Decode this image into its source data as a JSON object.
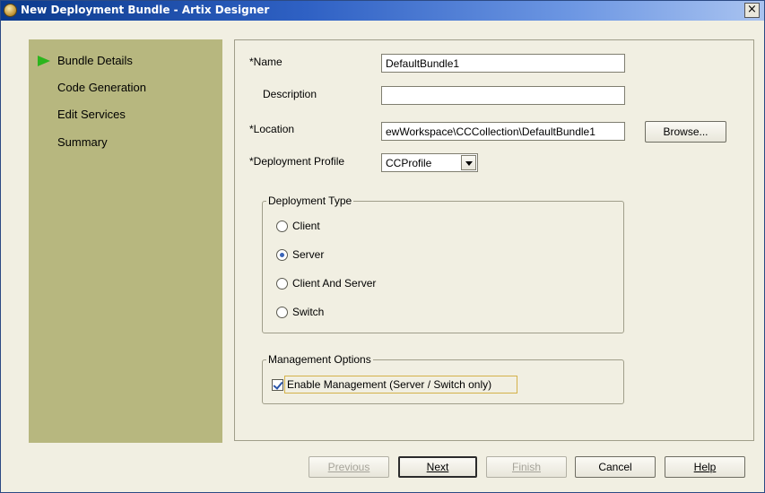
{
  "window": {
    "title": "New Deployment Bundle - Artix Designer",
    "close_label": "×"
  },
  "nav": {
    "items": [
      {
        "label": "Bundle Details",
        "active": true
      },
      {
        "label": "Code Generation"
      },
      {
        "label": "Edit Services"
      },
      {
        "label": "Summary"
      }
    ]
  },
  "form": {
    "name_label": "*Name",
    "name_value": "DefaultBundle1",
    "description_label": "Description",
    "description_value": "",
    "location_label": "*Location",
    "location_value": "ewWorkspace\\CCCollection\\DefaultBundle1",
    "browse_label": "Browse...",
    "profile_label": "*Deployment Profile",
    "profile_value": "CCProfile"
  },
  "deployment_type": {
    "title": "Deployment Type",
    "options": [
      {
        "label": "Client",
        "checked": false
      },
      {
        "label": "Server",
        "checked": true
      },
      {
        "label": "Client And Server",
        "checked": false
      },
      {
        "label": "Switch",
        "checked": false
      }
    ]
  },
  "management": {
    "title": "Management Options",
    "checkbox_label": "Enable Management (Server / Switch only)",
    "checked": true
  },
  "footer": {
    "previous_label": "Previous",
    "next_label": "Next",
    "finish_label": "Finish",
    "cancel_label": "Cancel",
    "help_label": "Help"
  },
  "colors": {
    "nav_background": "#b7b77f",
    "nav_arrow": "#2bb51d",
    "dialog_background": "#f1efe2",
    "titlebar_start": "#0b3a8c"
  }
}
